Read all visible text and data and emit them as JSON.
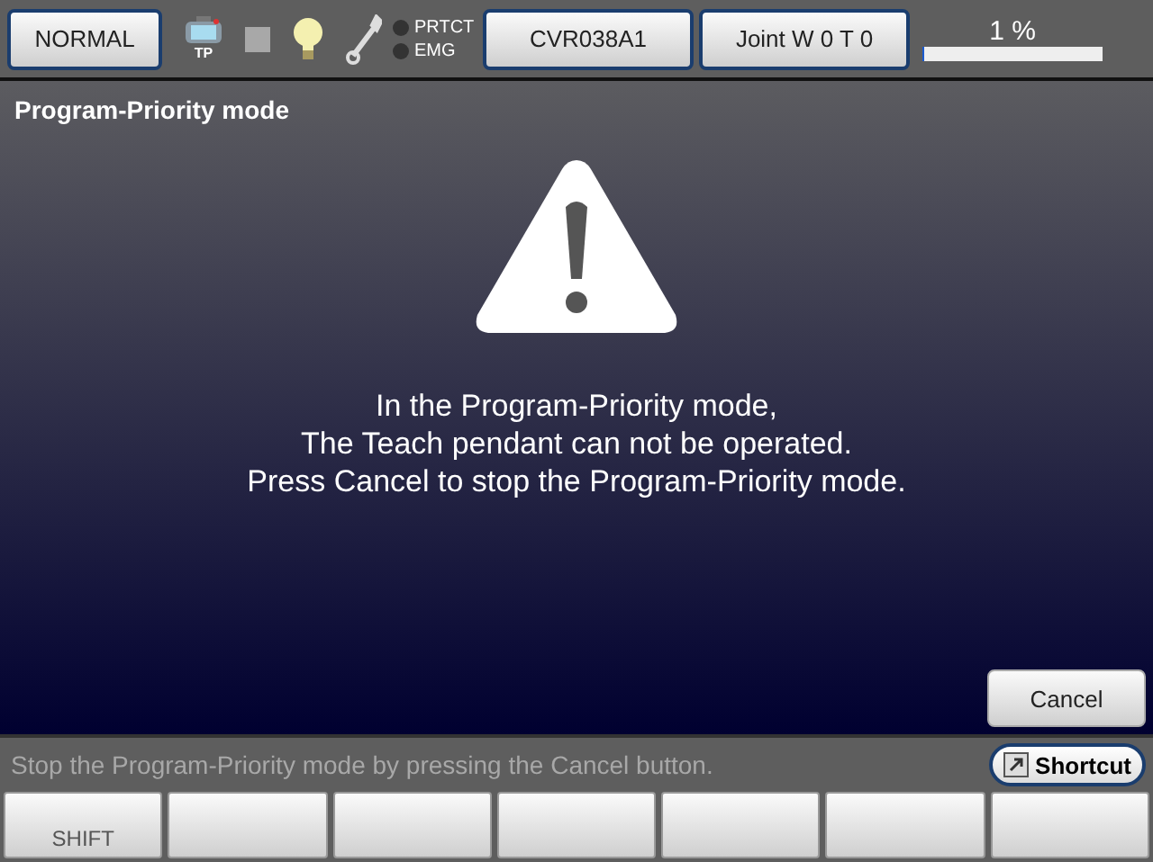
{
  "top_bar": {
    "mode_button": "NORMAL",
    "tp_label": "TP",
    "lamps": [
      {
        "label": "PRTCT",
        "on": false
      },
      {
        "label": "EMG",
        "on": false
      }
    ],
    "program_button": "CVR038A1",
    "coord_button": "Joint  W 0 T 0",
    "override": {
      "reading": "1 %",
      "level": 0.01
    }
  },
  "title": "Program-Priority mode",
  "message": [
    "In the Program-Priority mode,",
    "The Teach pendant can not be operated.",
    "Press Cancel to stop the Program-Priority mode."
  ],
  "cancel_button": "Cancel",
  "status_message": "Stop the Program-Priority mode by pressing the Cancel button.",
  "shortcut_button": "Shortcut",
  "function_keys": [
    {
      "kind": "labeled",
      "label": "SHIFT"
    },
    {
      "kind": "blank"
    },
    {
      "kind": "blank"
    },
    {
      "kind": "blank"
    },
    {
      "kind": "blank"
    },
    {
      "kind": "blank"
    },
    {
      "kind": "blank"
    }
  ]
}
